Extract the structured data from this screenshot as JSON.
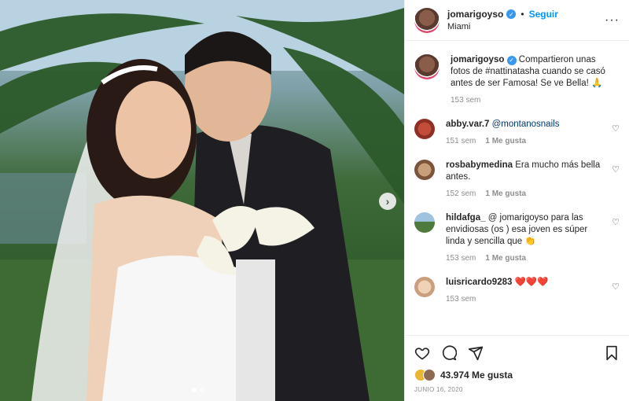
{
  "post": {
    "username": "jomarigoyso",
    "separator": "•",
    "follow_label": "Seguir",
    "location": "Miami",
    "caption": "Compartieron unas fotos de #nattinatasha cuando se casó antes de ser Famosa! Se ve Bella! 🙏",
    "caption_time": "153 sem",
    "likes": "43.974 Me gusta",
    "date": "JUNIO 16, 2020"
  },
  "comments": [
    {
      "user": "abby.var.7",
      "text": "@montanosnails",
      "time": "151 sem",
      "likes": "1 Me gusta"
    },
    {
      "user": "rosbabymedina",
      "text": "Era mucho más bella antes.",
      "time": "152 sem",
      "likes": "1 Me gusta"
    },
    {
      "user": "hildafga_",
      "text": "@ jomarigoyso para las envidiosas (os ) esa joven es súper linda y sencilla que 👏",
      "time": "153 sem",
      "likes": "1 Me gusta"
    },
    {
      "user": "luisricardo9283",
      "text": "❤️❤️❤️",
      "time": "153 sem",
      "likes": ""
    }
  ],
  "colors": {
    "accent": "#0095f6",
    "verified": "#3897f0",
    "muted": "#8e8e8e"
  },
  "icons": [
    "verified-icon",
    "more-options-icon",
    "heart-icon",
    "comment-icon",
    "share-icon",
    "save-icon",
    "next-arrow-icon"
  ]
}
